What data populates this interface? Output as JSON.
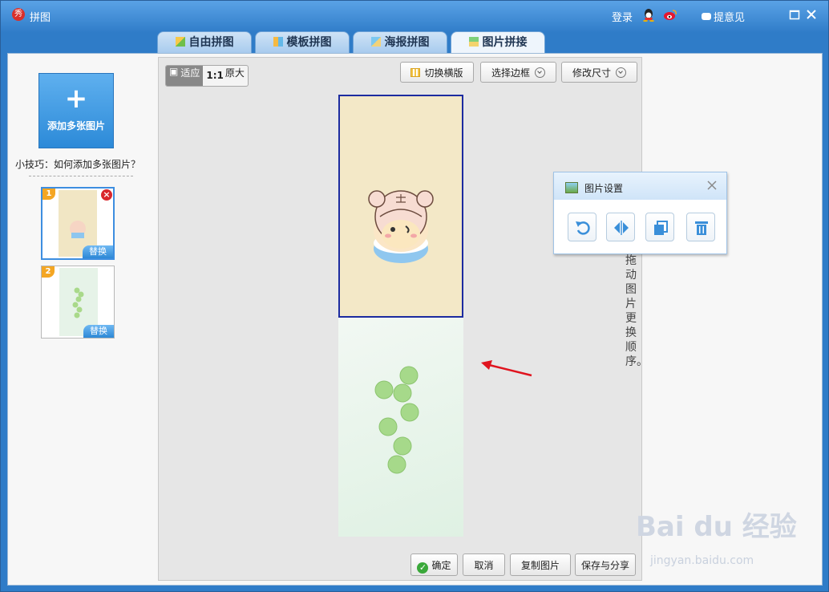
{
  "window": {
    "app_logo_text": "秀",
    "title": "拼图",
    "login": "登录",
    "feedback": "提意见"
  },
  "tabs": [
    {
      "label": "自由拼图",
      "icon": "free-collage-icon"
    },
    {
      "label": "模板拼图",
      "icon": "template-icon"
    },
    {
      "label": "海报拼图",
      "icon": "poster-icon"
    },
    {
      "label": "图片拼接",
      "icon": "stitch-icon",
      "active": true
    }
  ],
  "sidebar": {
    "add_button": "添加多张图片",
    "tip": "小技巧：如何添加多张图片？",
    "thumbnails": [
      {
        "index": "1",
        "replace": "替换",
        "selected": true
      },
      {
        "index": "2",
        "replace": "替换",
        "selected": false
      }
    ]
  },
  "canvas_toolbar": {
    "fit": "适应",
    "original_prefix": "1:1",
    "original": "原大",
    "switch_layout": "切换横版",
    "select_border": "选择边框",
    "resize": "修改尺寸"
  },
  "annotation": "可拖动图片更换顺序。",
  "image_settings": {
    "title": "图片设置",
    "tools": [
      "rotate-icon",
      "flip-horizontal-icon",
      "copy-icon",
      "delete-icon"
    ]
  },
  "bottom": {
    "confirm": "确定",
    "cancel": "取消",
    "copy": "复制图片",
    "save_share": "保存与分享"
  },
  "watermark": {
    "brand": "Bai du 经验",
    "url": "jingyan.baidu.com"
  },
  "colors": {
    "titlebar": "#2f7cc8",
    "selection": "#1c2ba0",
    "accent": "#2c8ad8"
  }
}
